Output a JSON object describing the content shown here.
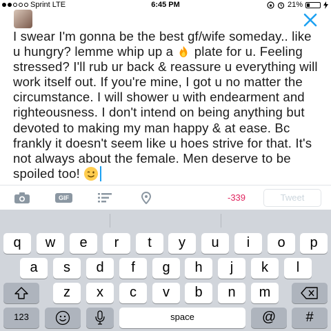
{
  "status_bar": {
    "carrier": "Sprint",
    "network": "LTE",
    "time": "6:45 PM",
    "battery": "21%",
    "battery_level": 0.21
  },
  "composer": {
    "text_parts": [
      "I swear I'm gonna be the best gf/wife someday.. like u hungry? lemme whip up a ",
      " plate for u. Feeling stressed? I'll rub ur back & reassure u everything will work itself out. If you're mine, I got u no matter the circumstance. I will shower u with endearment and righteousness. I don't intend on being anything but devoted to making my man happy & at ease. Bc frankly it doesn't seem like u hoes strive for that. It's not always about the female. Men deserve to be spoiled too! "
    ],
    "emoji_1": "fire-icon",
    "emoji_2": "winking-face-icon"
  },
  "toolbar": {
    "gif_label": "GIF",
    "char_count": "-339",
    "tweet_label": "Tweet"
  },
  "keyboard": {
    "row1": [
      "q",
      "w",
      "e",
      "r",
      "t",
      "y",
      "u",
      "i",
      "o",
      "p"
    ],
    "row2": [
      "a",
      "s",
      "d",
      "f",
      "g",
      "h",
      "j",
      "k",
      "l"
    ],
    "row3": [
      "z",
      "x",
      "c",
      "v",
      "b",
      "n",
      "m"
    ],
    "numbers_label": "123",
    "space_label": "space",
    "at_label": "@",
    "hash_label": "#"
  },
  "colors": {
    "accent": "#1da1f2",
    "char_count_negative": "#e0245e",
    "keyboard_bg": "#d1d5db"
  }
}
